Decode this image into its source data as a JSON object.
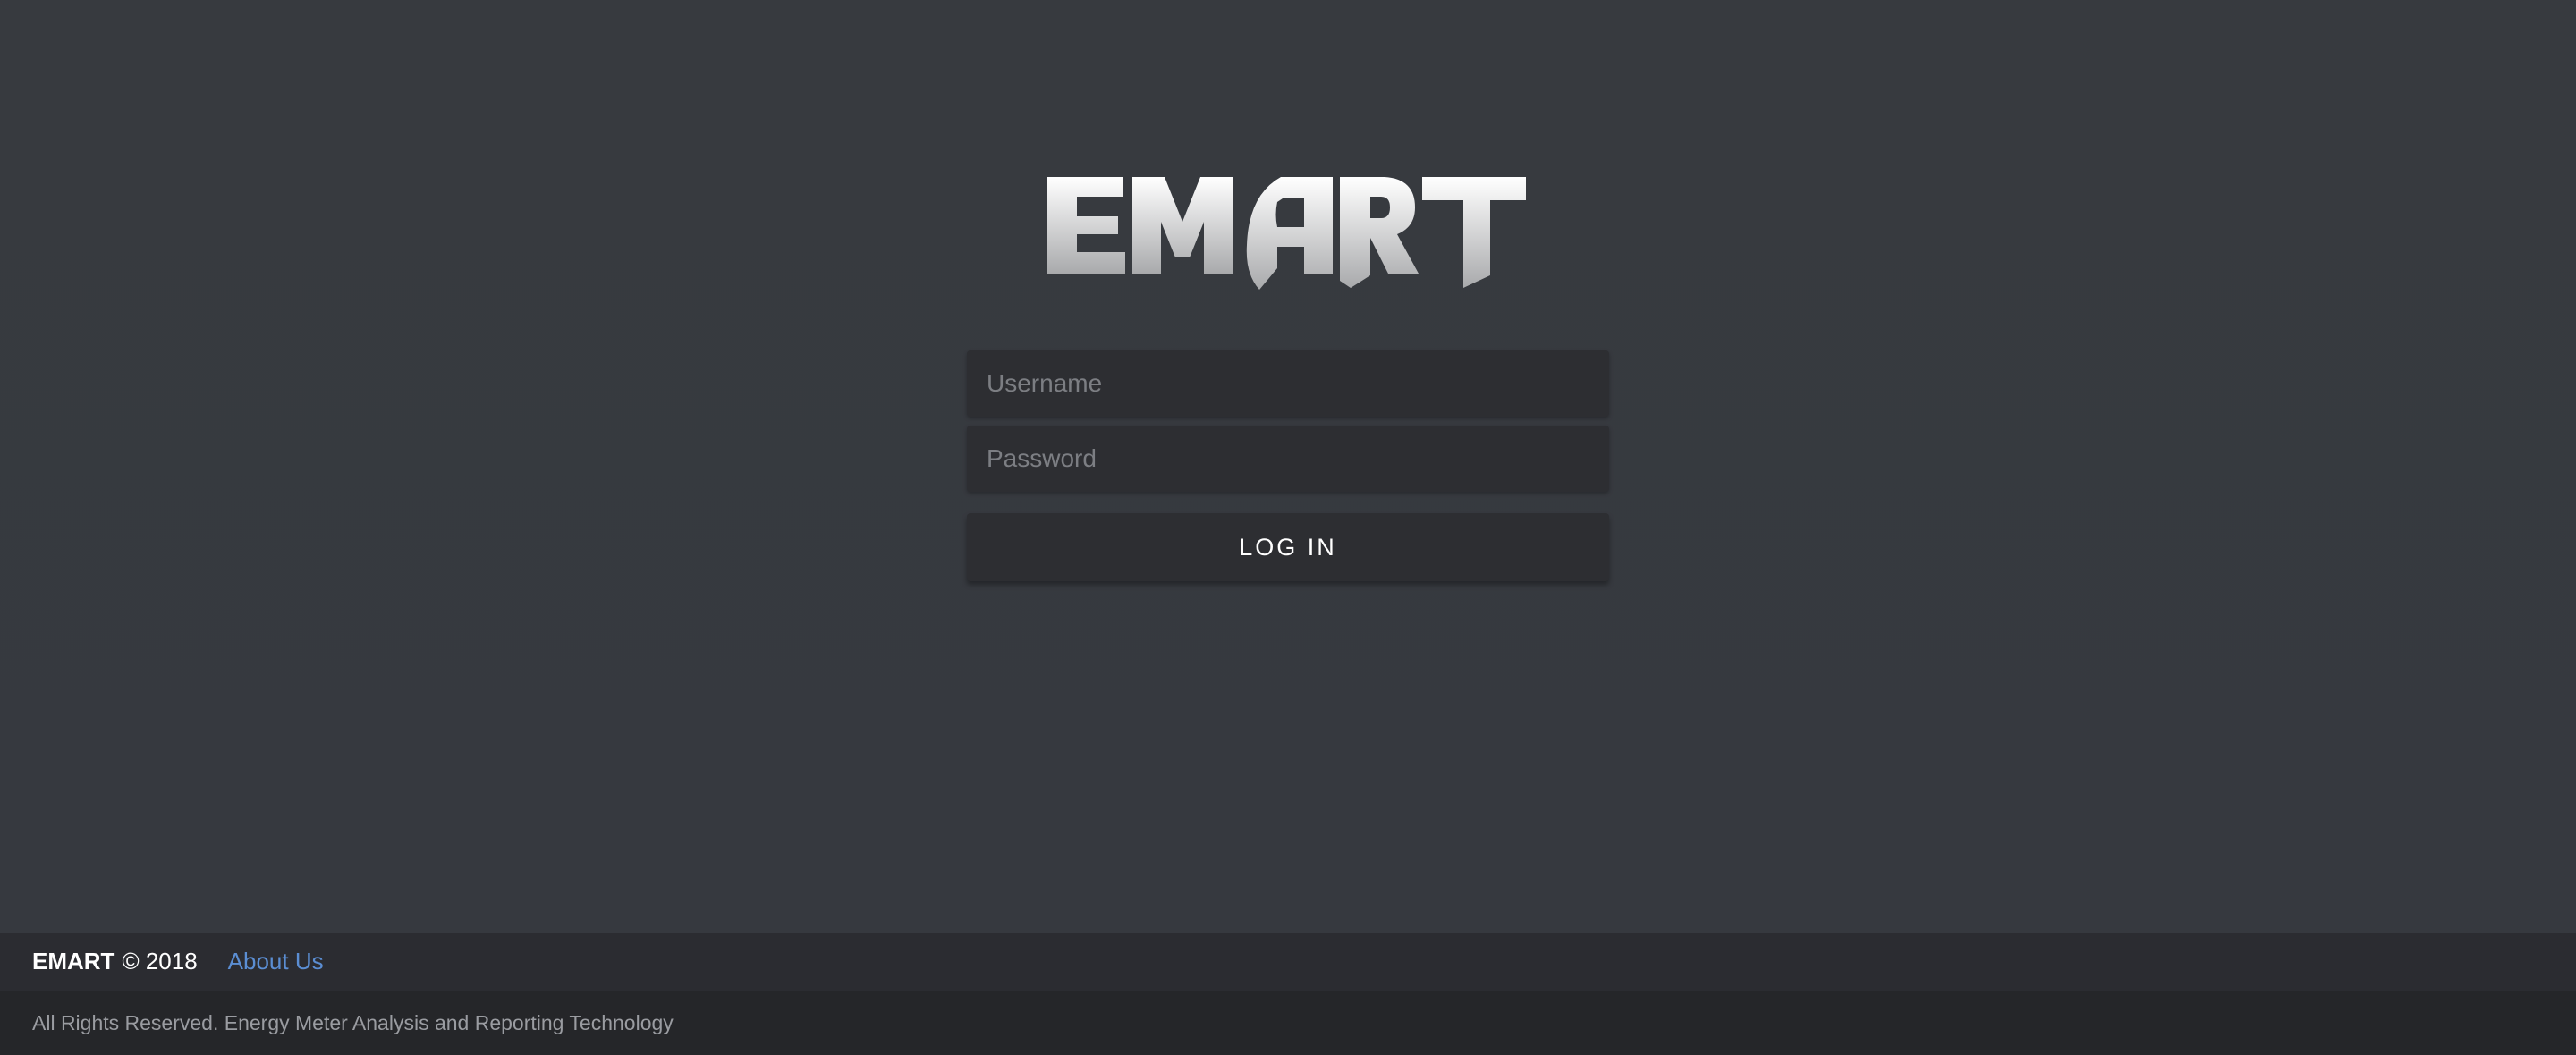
{
  "logo": {
    "text": "EMART",
    "gradient_top": "#ffffff",
    "gradient_bottom": "#a9aaac"
  },
  "login": {
    "username_placeholder": "Username",
    "password_placeholder": "Password",
    "button_label": "LOG IN"
  },
  "footer": {
    "brand": "EMART",
    "copyright": "© 2018",
    "about_link": "About Us",
    "rights": "All Rights Reserved. Energy Meter Analysis and Reporting Technology"
  },
  "colors": {
    "background": "#363a40",
    "field_background": "#2d2e32",
    "link": "#5b8ed3",
    "footer_top": "#2b2c31",
    "footer_bottom": "#252629"
  }
}
